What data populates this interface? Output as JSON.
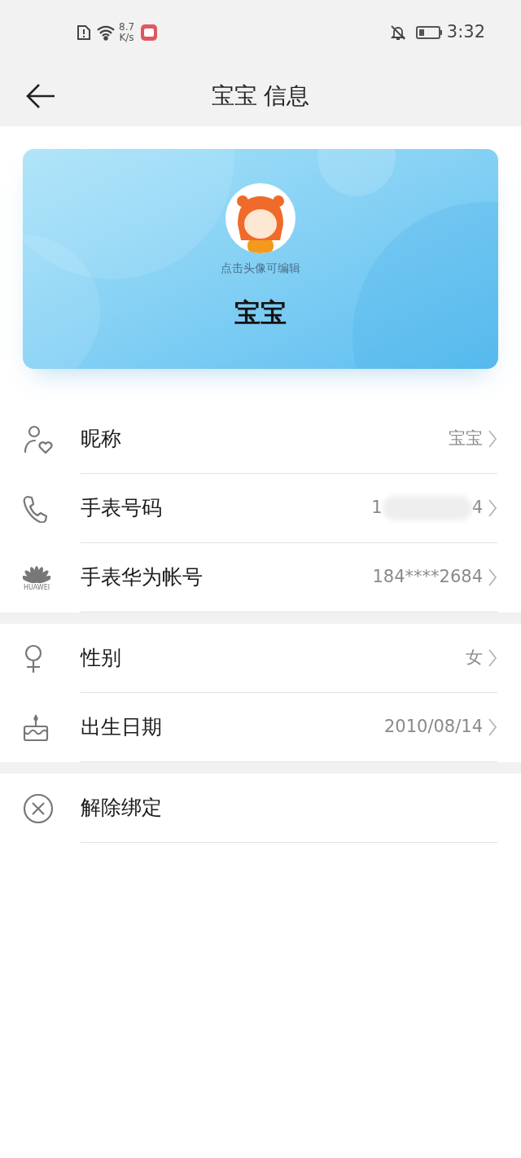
{
  "status_bar": {
    "speed_value": "8.7",
    "speed_unit": "K/s",
    "time": "3:32"
  },
  "header": {
    "title": "宝宝 信息"
  },
  "profile": {
    "hint": "点击头像可编辑",
    "name": "宝宝"
  },
  "sections": [
    {
      "rows": [
        {
          "kind": "nickname",
          "label": "昵称",
          "value": "宝宝"
        },
        {
          "kind": "phone",
          "label": "手表号码",
          "value_start": "1",
          "value_end": "4",
          "redacted": true
        },
        {
          "kind": "account",
          "label": "手表华为帐号",
          "value": "184****2684",
          "logo_text": "HUAWEI"
        }
      ]
    },
    {
      "rows": [
        {
          "kind": "gender",
          "label": "性别",
          "value": "女"
        },
        {
          "kind": "birthday",
          "label": "出生日期",
          "value": "2010/08/14"
        }
      ]
    },
    {
      "rows": [
        {
          "kind": "unbind",
          "label": "解除绑定"
        }
      ]
    }
  ]
}
